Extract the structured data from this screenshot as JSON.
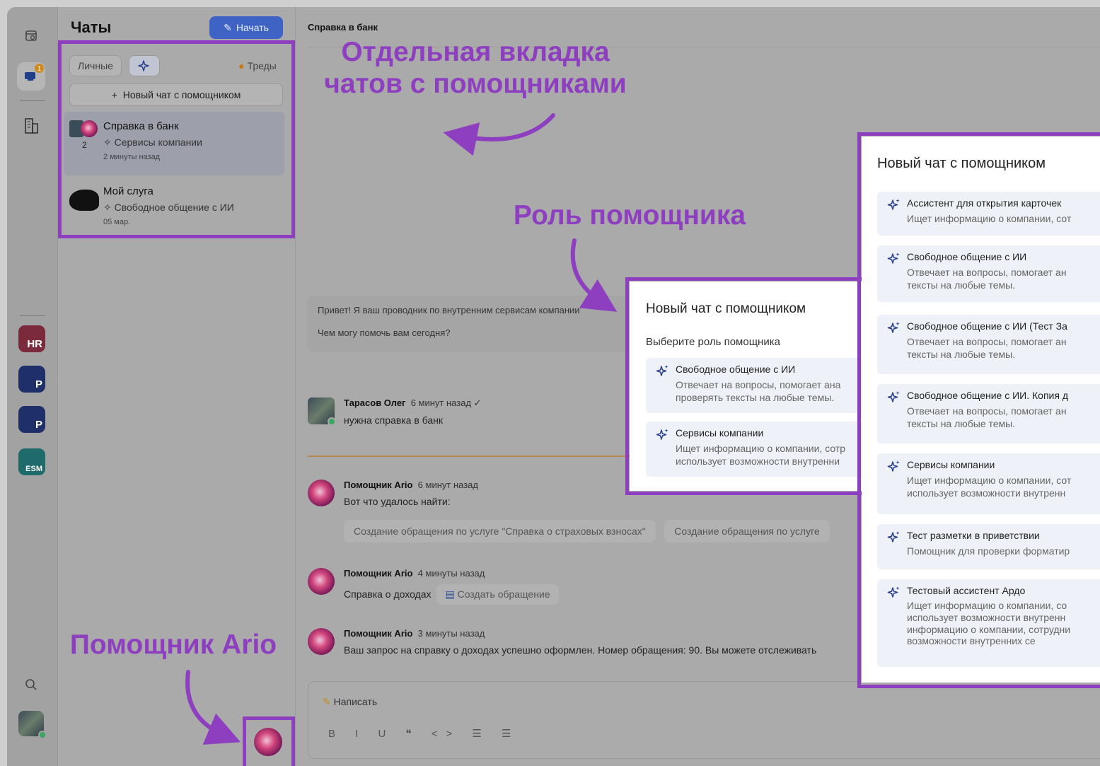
{
  "rail": {
    "badge_count": "1",
    "apps": [
      {
        "label": "HR",
        "color": "#7a2a3a"
      },
      {
        "label": "P",
        "color": "#1f2f6a"
      },
      {
        "label": "P",
        "color": "#1f2f6a"
      },
      {
        "label": "ESM",
        "color": "#1f6a6a"
      }
    ]
  },
  "panel": {
    "title": "Чаты",
    "start_label": "Начать",
    "tabs": {
      "personal": "Личные",
      "threads": "Треды"
    },
    "new_chat_label": "Новый чат с помощником",
    "chats": [
      {
        "name": "Справка в банк",
        "role": "Сервисы компании",
        "time": "2 минуты назад",
        "count": "2"
      },
      {
        "name": "Мой слуга",
        "role": "Свободное общение с ИИ",
        "time": "05 мар."
      }
    ]
  },
  "main": {
    "title": "Справка в банк",
    "greeting_line1": "Привет! Я ваш проводник по внутренним сервисам компании",
    "greeting_line2": "Чем могу помочь вам сегодня?",
    "messages": [
      {
        "author": "Тарасов Олег",
        "time": "6 минут назад",
        "text": "нужна справка в банк"
      },
      {
        "author": "Помощник Ario",
        "time": "6 минут назад",
        "text": "Вот что удалось найти:"
      },
      {
        "author": "Помощник Ario",
        "time": "4 минуты назад",
        "text": "Справка о доходах"
      },
      {
        "author": "Помощник Ario",
        "time": "3 минуты назад",
        "text": "Ваш запрос на справку о доходах успешно оформлен. Номер обращения: 90. Вы можете отслеживать"
      }
    ],
    "suggestions": [
      "Создание обращения по услуге \"Справка о страховых взносах\"",
      "Создание обращения по услуге"
    ],
    "create_request_label": "Создать обращение",
    "composer_placeholder": "Написать",
    "composer_tools": "B I U ❝ <> ☰ ☰"
  },
  "popup_small": {
    "title": "Новый чат с помощником",
    "subtitle": "Выберите роль помощника",
    "roles": [
      {
        "name": "Свободное общение с ИИ",
        "desc": "Отвечает на вопросы, помогает ана\nпроверять тексты на любые темы."
      },
      {
        "name": "Сервисы компании",
        "desc": "Ищет информацию о компании, сотр\nиспользует возможности внутренни"
      }
    ]
  },
  "popup_big": {
    "title": "Новый чат с помощником",
    "roles": [
      {
        "name": "Ассистент для открытия карточек",
        "desc": "Ищет информацию о компании, сот"
      },
      {
        "name": "Свободное общение с ИИ",
        "desc": "Отвечает на вопросы, помогает ан\nтексты на любые темы."
      },
      {
        "name": "Свободное общение с ИИ (Тест За",
        "desc": "Отвечает на вопросы, помогает ан\nтексты на любые темы."
      },
      {
        "name": "Свободное общение с ИИ. Копия д",
        "desc": "Отвечает на вопросы, помогает ан\nтексты на любые темы."
      },
      {
        "name": "Сервисы компании",
        "desc": "Ищет информацию о компании, сот\nиспользует возможности внутренн"
      },
      {
        "name": "Тест разметки в приветствии",
        "desc": "Помощник для проверки форматир"
      },
      {
        "name": "Тестовый ассистент Ардо",
        "desc": "Ищет информацию о компании, со\nиспользует возможности внутренн\nинформацию о компании, сотрудни\nвозможности внутренних се"
      }
    ]
  },
  "annotations": {
    "tab_note": "Отдельная вкладка\nчатов с помощниками",
    "role_note": "Роль помощника",
    "ario_note": "Помощник Ario"
  },
  "colors": {
    "accent": "#8e3fc0",
    "start_button": "#3e63c4"
  }
}
